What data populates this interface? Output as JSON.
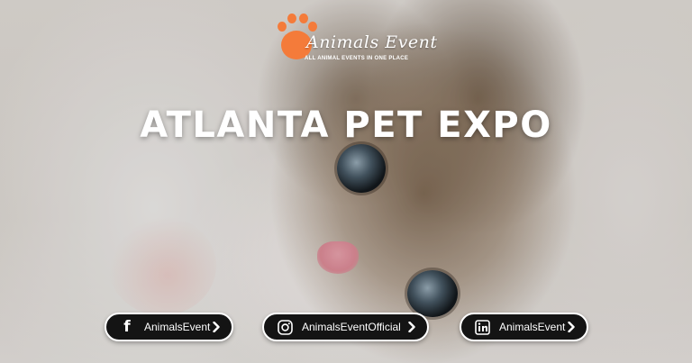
{
  "logo": {
    "title": "Animals Event",
    "tagline": "ALL ANIMAL EVENTS IN ONE PLACE",
    "mark_icon": "paw-icon",
    "mark_color": "#f47b3a"
  },
  "headline": "ATLANTA PET EXPO",
  "social": [
    {
      "network": "facebook",
      "icon": "facebook-icon",
      "label": "AnimalsEvent"
    },
    {
      "network": "instagram",
      "icon": "instagram-icon",
      "label": "AnimalsEventOfficial"
    },
    {
      "network": "linkedin",
      "icon": "linkedin-icon",
      "label": "AnimalsEvent"
    }
  ],
  "colors": {
    "pill_background": "#141414",
    "pill_border": "#ffffff",
    "text": "#ffffff"
  }
}
